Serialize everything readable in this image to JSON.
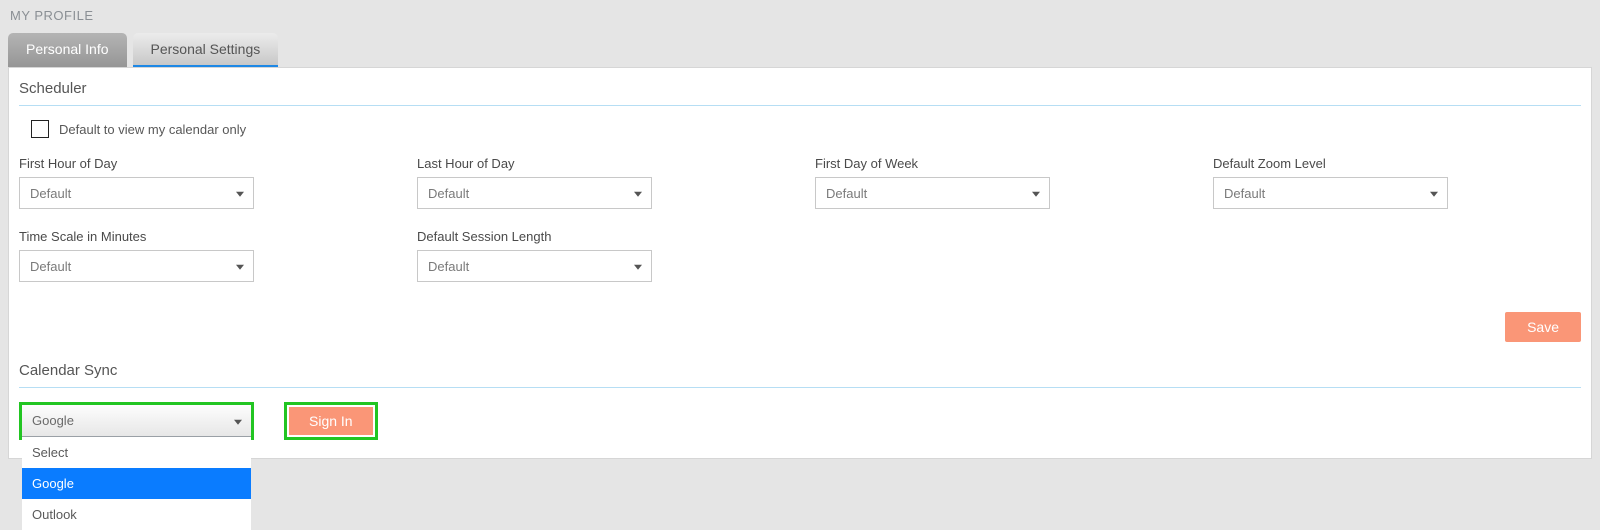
{
  "page_title": "MY PROFILE",
  "tabs": {
    "personal_info": "Personal Info",
    "personal_settings": "Personal Settings"
  },
  "scheduler": {
    "title": "Scheduler",
    "checkbox_label": "Default to view my calendar only",
    "fields": {
      "first_hour": {
        "label": "First Hour of Day",
        "value": "Default"
      },
      "last_hour": {
        "label": "Last Hour of Day",
        "value": "Default"
      },
      "first_day": {
        "label": "First Day of Week",
        "value": "Default"
      },
      "zoom_level": {
        "label": "Default Zoom Level",
        "value": "Default"
      },
      "time_scale": {
        "label": "Time Scale in Minutes",
        "value": "Default"
      },
      "session_length": {
        "label": "Default Session Length",
        "value": "Default"
      }
    },
    "save_label": "Save"
  },
  "calendar_sync": {
    "title": "Calendar Sync",
    "selected": "Google",
    "options": {
      "select": "Select",
      "google": "Google",
      "outlook": "Outlook"
    },
    "signin_label": "Sign In"
  }
}
